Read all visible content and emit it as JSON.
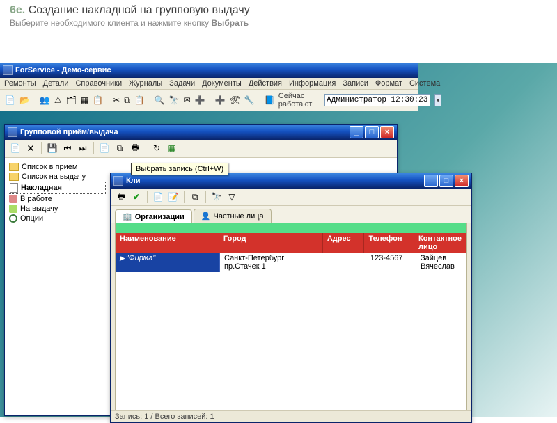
{
  "slide": {
    "number": "6e",
    "title": "Создание накладной на групповую выдачу",
    "subtitle_pre": "Выберите необходимого клиента и нажмите кнопку ",
    "subtitle_bold": "Выбрать"
  },
  "main_window": {
    "title": "ForService - Демо-сервис",
    "menu": [
      "Ремонты",
      "Детали",
      "Справочники",
      "Журналы",
      "Задачи",
      "Документы",
      "Действия",
      "Информация",
      "Записи",
      "Формат",
      "Система"
    ],
    "status_label": "Сейчас работают",
    "status_value": "Администратор 12:30:23"
  },
  "group_window": {
    "title": "Групповой приём/выдача",
    "tree": [
      {
        "icon": "folder",
        "label": "Список в прием"
      },
      {
        "icon": "folder",
        "label": "Список на выдачу"
      },
      {
        "icon": "doc",
        "label": "Накладная",
        "selected": true
      },
      {
        "icon": "wrench",
        "label": "В работе"
      },
      {
        "icon": "out",
        "label": "На выдачу"
      },
      {
        "icon": "gear",
        "label": "Опции"
      }
    ]
  },
  "client_window": {
    "title": "Кли",
    "tooltip": "Выбрать запись (Ctrl+W)",
    "tabs": [
      {
        "label": "Организации",
        "active": true
      },
      {
        "label": "Частные лица",
        "active": false
      }
    ],
    "columns": {
      "name": "Наименование",
      "city": "Город",
      "addr": "Адрес",
      "phone": "Телефон",
      "contact": "Контактное лицо"
    },
    "row": {
      "name": "\"Фирма\"",
      "city": "Санкт-Петербург",
      "addr": "пр.Стачек 1",
      "phone": "123-4567",
      "contact": "Зайцев Вячеслав"
    },
    "status": "Запись: 1 / Всего записей: 1"
  }
}
